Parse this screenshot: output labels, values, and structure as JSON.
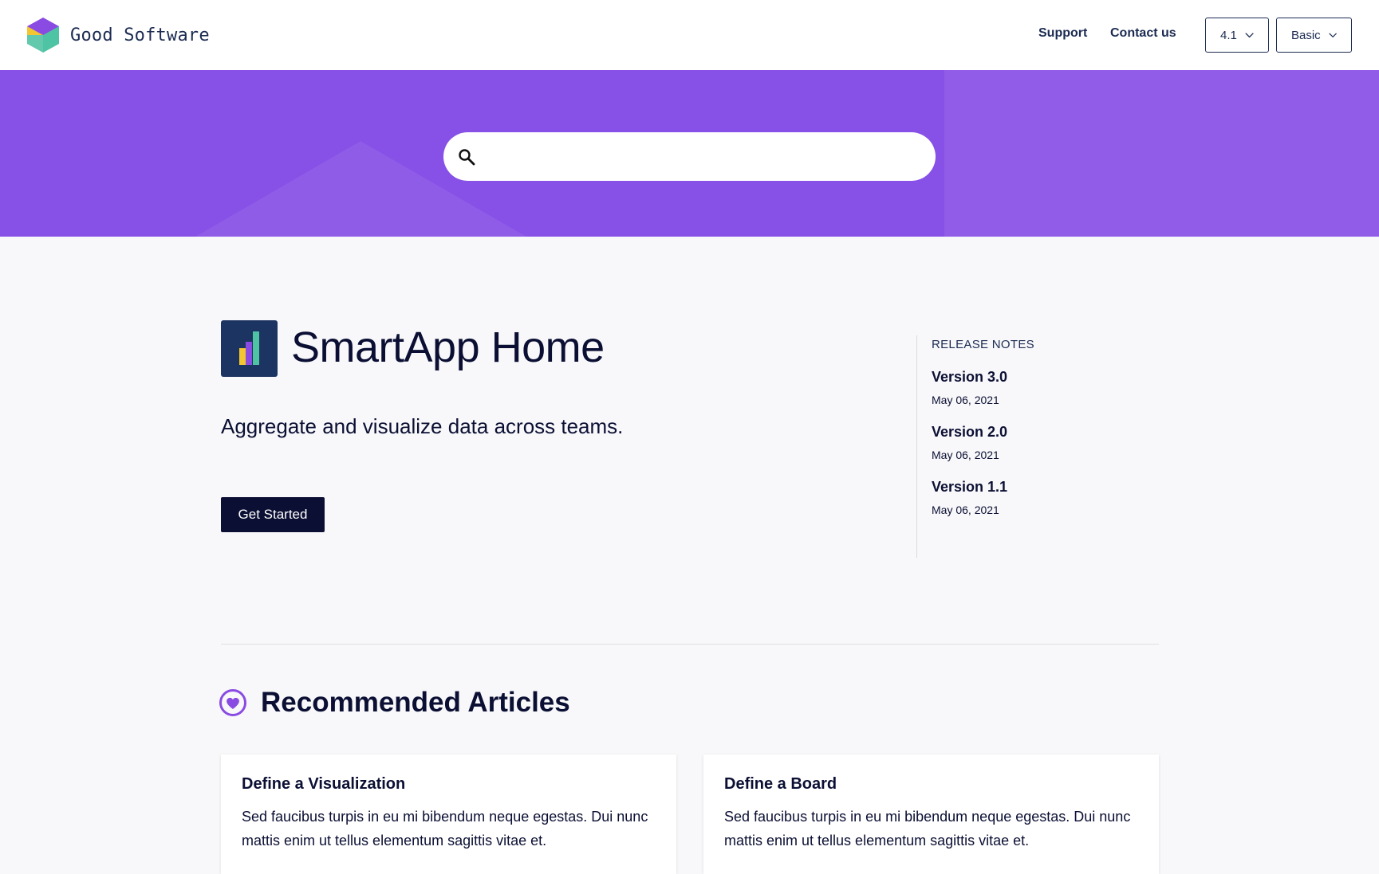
{
  "header": {
    "brand": "Good Software",
    "nav": [
      {
        "label": "Support"
      },
      {
        "label": "Contact us"
      }
    ],
    "version_select": "4.1",
    "plan_select": "Basic"
  },
  "search": {
    "placeholder": ""
  },
  "main": {
    "title": "SmartApp Home",
    "subtitle": "Aggregate and visualize data across teams.",
    "cta_label": "Get Started"
  },
  "release_notes": {
    "heading": "RELEASE NOTES",
    "items": [
      {
        "version": "Version 3.0",
        "date": "May 06, 2021"
      },
      {
        "version": "Version 2.0",
        "date": "May 06, 2021"
      },
      {
        "version": "Version 1.1",
        "date": "May 06, 2021"
      }
    ]
  },
  "recommended": {
    "heading": "Recommended Articles",
    "cards": [
      {
        "title": "Define a Visualization",
        "text": "Sed faucibus turpis in eu mi bibendum neque egestas. Dui nunc mattis enim ut tellus elementum sagittis vitae et."
      },
      {
        "title": "Define a Board",
        "text": "Sed faucibus turpis in eu mi bibendum neque egestas. Dui nunc mattis enim ut tellus elementum sagittis vitae et."
      }
    ]
  },
  "colors": {
    "hero": "#8750e6",
    "accent": "#7b44de",
    "navy": "#0b0f33"
  },
  "icons": [
    "hexagon-logo-icon",
    "chevron-down-icon",
    "search-icon",
    "bar-chart-icon",
    "heart-icon"
  ]
}
